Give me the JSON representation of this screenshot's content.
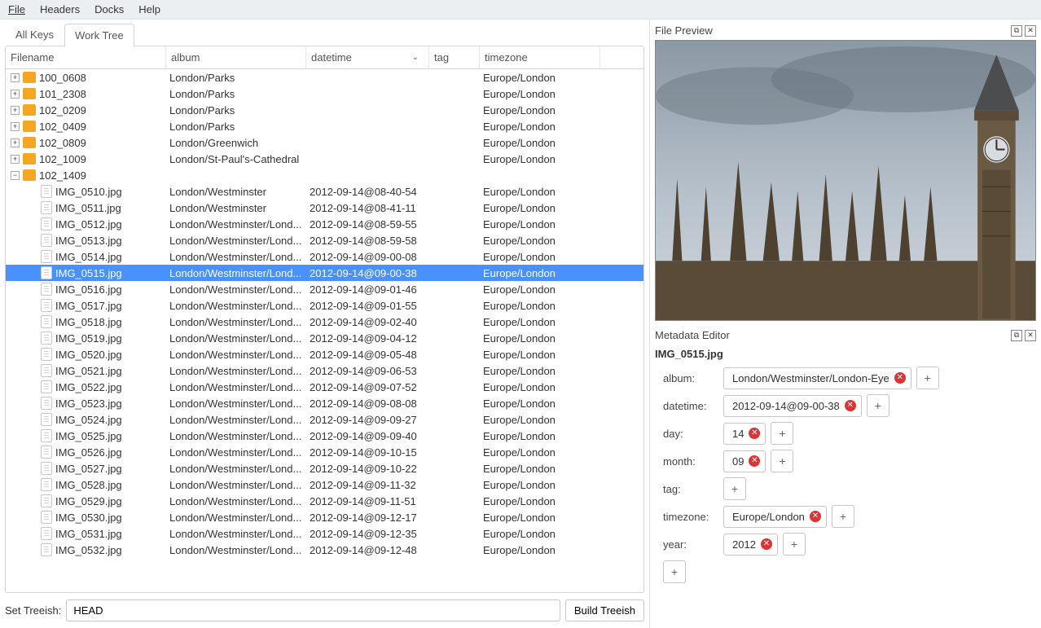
{
  "menubar": {
    "items": [
      "File",
      "Headers",
      "Docks",
      "Help"
    ]
  },
  "tabs": {
    "all_keys": "All Keys",
    "work_tree": "Work Tree",
    "active_index": 1
  },
  "columns": {
    "filename": "Filename",
    "album": "album",
    "datetime": "datetime",
    "tag": "tag",
    "timezone": "timezone"
  },
  "folders": [
    {
      "name": "100_0608",
      "album": "London/Parks",
      "timezone": "Europe/London",
      "expanded": false
    },
    {
      "name": "101_2308",
      "album": "London/Parks",
      "timezone": "Europe/London",
      "expanded": false
    },
    {
      "name": "102_0209",
      "album": "London/Parks",
      "timezone": "Europe/London",
      "expanded": false
    },
    {
      "name": "102_0409",
      "album": "London/Parks",
      "timezone": "Europe/London",
      "expanded": false
    },
    {
      "name": "102_0809",
      "album": "London/Greenwich",
      "timezone": "Europe/London",
      "expanded": false
    },
    {
      "name": "102_1009",
      "album": "London/St-Paul's-Cathedral",
      "timezone": "Europe/London",
      "expanded": false
    },
    {
      "name": "102_1409",
      "album": "",
      "timezone": "",
      "expanded": true
    }
  ],
  "files": [
    {
      "name": "IMG_0510.jpg",
      "album": "London/Westminster",
      "datetime": "2012-09-14@08-40-54",
      "timezone": "Europe/London"
    },
    {
      "name": "IMG_0511.jpg",
      "album": "London/Westminster",
      "datetime": "2012-09-14@08-41-11",
      "timezone": "Europe/London"
    },
    {
      "name": "IMG_0512.jpg",
      "album": "London/Westminster/Lond...",
      "datetime": "2012-09-14@08-59-55",
      "timezone": "Europe/London"
    },
    {
      "name": "IMG_0513.jpg",
      "album": "London/Westminster/Lond...",
      "datetime": "2012-09-14@08-59-58",
      "timezone": "Europe/London"
    },
    {
      "name": "IMG_0514.jpg",
      "album": "London/Westminster/Lond...",
      "datetime": "2012-09-14@09-00-08",
      "timezone": "Europe/London"
    },
    {
      "name": "IMG_0515.jpg",
      "album": "London/Westminster/Lond...",
      "datetime": "2012-09-14@09-00-38",
      "timezone": "Europe/London",
      "selected": true
    },
    {
      "name": "IMG_0516.jpg",
      "album": "London/Westminster/Lond...",
      "datetime": "2012-09-14@09-01-46",
      "timezone": "Europe/London"
    },
    {
      "name": "IMG_0517.jpg",
      "album": "London/Westminster/Lond...",
      "datetime": "2012-09-14@09-01-55",
      "timezone": "Europe/London"
    },
    {
      "name": "IMG_0518.jpg",
      "album": "London/Westminster/Lond...",
      "datetime": "2012-09-14@09-02-40",
      "timezone": "Europe/London"
    },
    {
      "name": "IMG_0519.jpg",
      "album": "London/Westminster/Lond...",
      "datetime": "2012-09-14@09-04-12",
      "timezone": "Europe/London"
    },
    {
      "name": "IMG_0520.jpg",
      "album": "London/Westminster/Lond...",
      "datetime": "2012-09-14@09-05-48",
      "timezone": "Europe/London"
    },
    {
      "name": "IMG_0521.jpg",
      "album": "London/Westminster/Lond...",
      "datetime": "2012-09-14@09-06-53",
      "timezone": "Europe/London"
    },
    {
      "name": "IMG_0522.jpg",
      "album": "London/Westminster/Lond...",
      "datetime": "2012-09-14@09-07-52",
      "timezone": "Europe/London"
    },
    {
      "name": "IMG_0523.jpg",
      "album": "London/Westminster/Lond...",
      "datetime": "2012-09-14@09-08-08",
      "timezone": "Europe/London"
    },
    {
      "name": "IMG_0524.jpg",
      "album": "London/Westminster/Lond...",
      "datetime": "2012-09-14@09-09-27",
      "timezone": "Europe/London"
    },
    {
      "name": "IMG_0525.jpg",
      "album": "London/Westminster/Lond...",
      "datetime": "2012-09-14@09-09-40",
      "timezone": "Europe/London"
    },
    {
      "name": "IMG_0526.jpg",
      "album": "London/Westminster/Lond...",
      "datetime": "2012-09-14@09-10-15",
      "timezone": "Europe/London"
    },
    {
      "name": "IMG_0527.jpg",
      "album": "London/Westminster/Lond...",
      "datetime": "2012-09-14@09-10-22",
      "timezone": "Europe/London"
    },
    {
      "name": "IMG_0528.jpg",
      "album": "London/Westminster/Lond...",
      "datetime": "2012-09-14@09-11-32",
      "timezone": "Europe/London"
    },
    {
      "name": "IMG_0529.jpg",
      "album": "London/Westminster/Lond...",
      "datetime": "2012-09-14@09-11-51",
      "timezone": "Europe/London"
    },
    {
      "name": "IMG_0530.jpg",
      "album": "London/Westminster/Lond...",
      "datetime": "2012-09-14@09-12-17",
      "timezone": "Europe/London"
    },
    {
      "name": "IMG_0531.jpg",
      "album": "London/Westminster/Lond...",
      "datetime": "2012-09-14@09-12-35",
      "timezone": "Europe/London"
    },
    {
      "name": "IMG_0532.jpg",
      "album": "London/Westminster/Lond...",
      "datetime": "2012-09-14@09-12-48",
      "timezone": "Europe/London"
    }
  ],
  "treeish": {
    "label": "Set Treeish:",
    "value": "HEAD",
    "button": "Build Treeish"
  },
  "preview": {
    "title": "File Preview"
  },
  "editor": {
    "title": "Metadata Editor",
    "filename": "IMG_0515.jpg",
    "fields": {
      "album": {
        "label": "album:",
        "value": "London/Westminster/London-Eye"
      },
      "datetime": {
        "label": "datetime:",
        "value": "2012-09-14@09-00-38"
      },
      "day": {
        "label": "day:",
        "value": "14"
      },
      "month": {
        "label": "month:",
        "value": "09"
      },
      "tag": {
        "label": "tag:",
        "value": null
      },
      "timezone": {
        "label": "timezone:",
        "value": "Europe/London"
      },
      "year": {
        "label": "year:",
        "value": "2012"
      }
    }
  }
}
